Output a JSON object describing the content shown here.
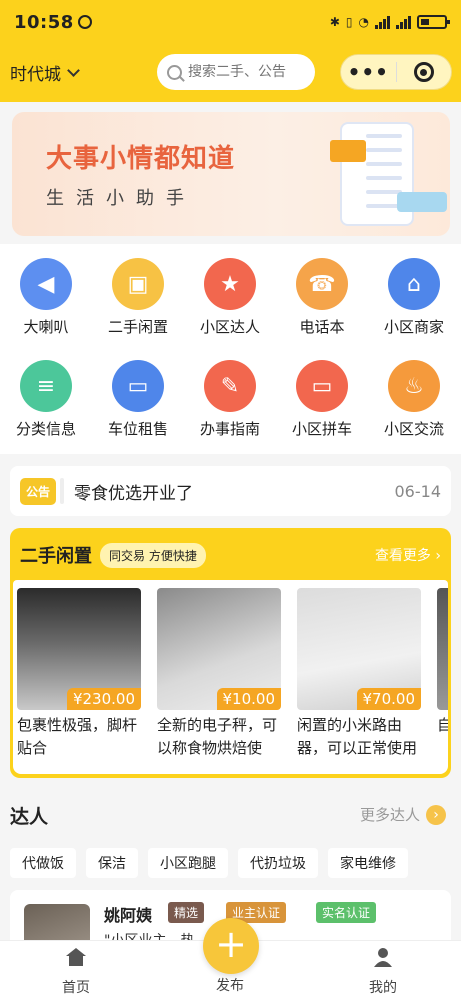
{
  "status_bar": {
    "time": "10:58"
  },
  "header": {
    "city": "时代城",
    "search_placeholder": "搜索二手、公告"
  },
  "banner": {
    "headline": "大事小情都知道",
    "subline": "生活小助手"
  },
  "grid_items": [
    {
      "label": "大喇叭",
      "icon": "megaphone-icon",
      "color": "#5d8ff0"
    },
    {
      "label": "二手闲置",
      "icon": "bag-icon",
      "color": "#f7c244"
    },
    {
      "label": "小区达人",
      "icon": "star-badge-icon",
      "color": "#f2674e"
    },
    {
      "label": "电话本",
      "icon": "phone-book-icon",
      "color": "#f5a44a"
    },
    {
      "label": "小区商家",
      "icon": "shop-icon",
      "color": "#4f86ea"
    },
    {
      "label": "分类信息",
      "icon": "list-icon",
      "color": "#4cc79a"
    },
    {
      "label": "车位租售",
      "icon": "car-icon",
      "color": "#4f86ea"
    },
    {
      "label": "办事指南",
      "icon": "guide-icon",
      "color": "#f2674e"
    },
    {
      "label": "小区拼车",
      "icon": "carpool-icon",
      "color": "#f2674e"
    },
    {
      "label": "小区交流",
      "icon": "fire-icon",
      "color": "#f59a3c"
    }
  ],
  "notice": {
    "badge": "公告",
    "text": "零食优选开业了",
    "date": "06-14"
  },
  "secondhand": {
    "title": "二手闲置",
    "pill": "同交易 方便快捷",
    "view_more": "查看更多",
    "items": [
      {
        "price": "¥230.00",
        "desc": "包裹性极强，脚杆贴合"
      },
      {
        "price": "¥10.00",
        "desc": "全新的电子秤，可以称食物烘焙使"
      },
      {
        "price": "¥70.00",
        "desc": "闲置的小米路由器，可以正常使用"
      },
      {
        "price": "",
        "desc": "自炒"
      }
    ]
  },
  "talent": {
    "title": "达人",
    "more": "更多达人",
    "tags": [
      "代做饭",
      "保洁",
      "小区跑腿",
      "代扔垃圾",
      "家电维修"
    ],
    "person": {
      "name": "姚阿姨",
      "badges": [
        {
          "text": "精选",
          "color": "#7a5a4e"
        },
        {
          "text": "业主认证",
          "color": "#d8943a"
        },
        {
          "text": "实名认证",
          "color": "#5cc06b"
        }
      ],
      "quote": "\"小区业主，热"
    }
  },
  "tabbar": {
    "home": "首页",
    "publish": "发布",
    "mine": "我的"
  }
}
